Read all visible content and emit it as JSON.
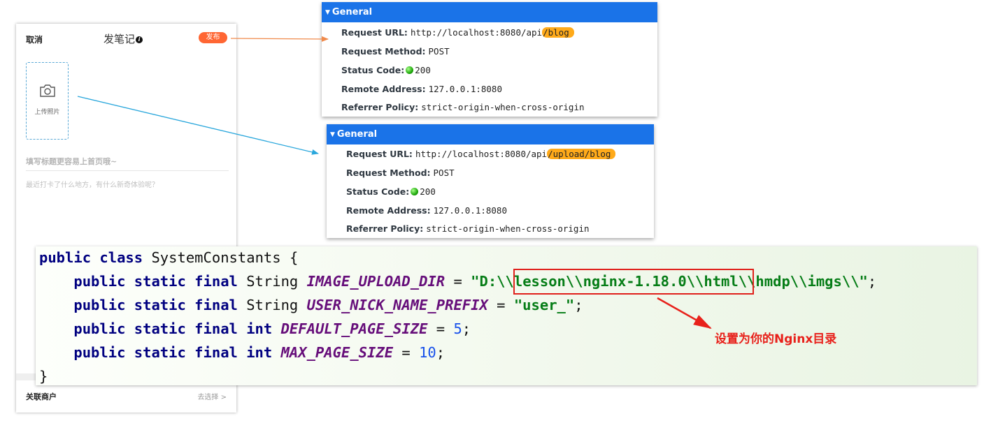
{
  "phone": {
    "cancel_label": "取消",
    "title": "发笔记",
    "info_glyph": "i",
    "publish_label": "发布",
    "upload_label": "上传照片",
    "title_placeholder": "填写标题更容易上首页哦~",
    "content_placeholder": "最近打卡了什么地方，有什么新奇体验呢？",
    "shop_label": "关联商户",
    "shop_choose": "去选择 >"
  },
  "panels": [
    {
      "header": "General",
      "url_key": "Request URL:",
      "url_prefix": "http://localhost:8080/api",
      "url_highlight": "/blog",
      "method_key": "Request Method:",
      "method_value": "POST",
      "status_key": "Status Code:",
      "status_value": "200",
      "remote_key": "Remote Address:",
      "remote_value": "127.0.0.1:8080",
      "referrer_key": "Referrer Policy:",
      "referrer_value": "strict-origin-when-cross-origin"
    },
    {
      "header": "General",
      "url_key": "Request URL:",
      "url_prefix": "http://localhost:8080/api",
      "url_highlight": "/upload/blog",
      "method_key": "Request Method:",
      "method_value": "POST",
      "status_key": "Status Code:",
      "status_value": "200",
      "remote_key": "Remote Address:",
      "remote_value": "127.0.0.1:8080",
      "referrer_key": "Referrer Policy:",
      "referrer_value": "strict-origin-when-cross-origin"
    }
  ],
  "code": {
    "kw_public": "public",
    "kw_class": "class",
    "class_name": " SystemConstants {",
    "kw_static_final": "public static final",
    "type_string": " String ",
    "type_int": "int",
    "const1": "IMAGE_UPLOAD_DIR",
    "const1_value": "\"D:\\\\lesson\\\\nginx-1.18.0\\\\html\\\\hmdp\\\\imgs\\\\\"",
    "const2": "USER_NICK_NAME_PREFIX",
    "const2_value": "\"user_\"",
    "const3": "DEFAULT_PAGE_SIZE",
    "const3_value": "5",
    "const4": "MAX_PAGE_SIZE",
    "const4_value": "10",
    "assign": " = ",
    "semicolon": ";",
    "close_brace": "}"
  },
  "annotation": {
    "note": "设置为你的Nginx目录",
    "arrow_color_orange": "#f08a4b",
    "arrow_color_blue": "#2aa7dc",
    "arrow_color_red": "#e8211b"
  }
}
